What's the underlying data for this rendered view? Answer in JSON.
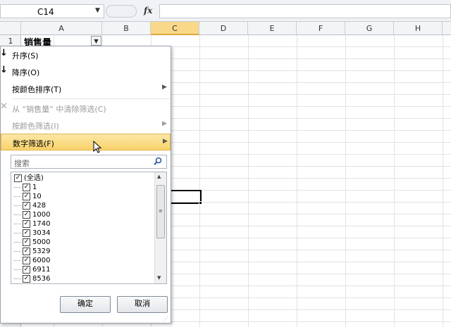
{
  "formula_bar": {
    "name_box": "C14",
    "fx": "fx",
    "formula": ""
  },
  "columns": [
    "A",
    "B",
    "C",
    "D",
    "E",
    "F",
    "G",
    "H"
  ],
  "active_column": "C",
  "rows": [
    "1"
  ],
  "cell_a1": "销售量",
  "menu": {
    "sort_asc": "升序(S)",
    "sort_desc": "降序(O)",
    "sort_by_color": "按颜色排序(T)",
    "clear_filter": "从 “销售量” 中清除筛选(C)",
    "filter_by_color": "按颜色筛选(I)",
    "number_filter": "数字筛选(F)",
    "search_placeholder": "搜索",
    "items": [
      "(全选)",
      "1",
      "10",
      "428",
      "1000",
      "1740",
      "3034",
      "5000",
      "5329",
      "6000",
      "6911",
      "8536"
    ],
    "ok": "确定",
    "cancel": "取消"
  },
  "colors": {
    "highlight": "#f8d26b",
    "active_header": "#f9d88a"
  }
}
